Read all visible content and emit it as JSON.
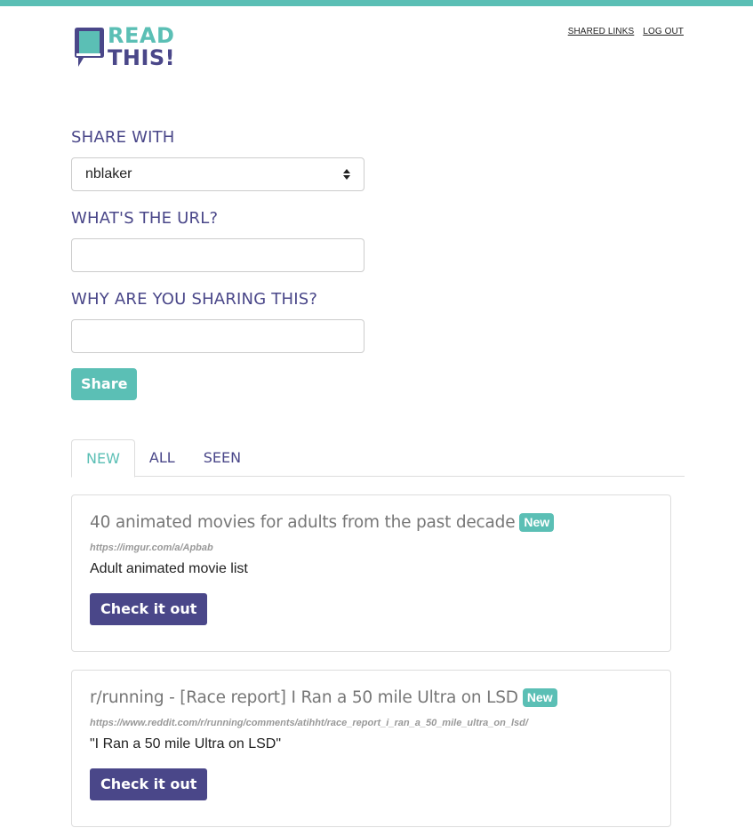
{
  "colors": {
    "teal": "#5bbfb5",
    "purple": "#4a4789",
    "label_purple": "#4a4789"
  },
  "logo": {
    "line1": "READ",
    "line2": "THIS!"
  },
  "nav": {
    "shared_links": "SHARED LINKS",
    "log_out": "LOG OUT"
  },
  "form": {
    "share_with_label": "SHARE WITH",
    "share_with_value": "nblaker",
    "url_label": "WHAT'S THE URL?",
    "url_value": "",
    "reason_label": "WHY ARE YOU SHARING THIS?",
    "reason_value": "",
    "share_button": "Share"
  },
  "tabs": [
    {
      "label": "NEW",
      "active": true
    },
    {
      "label": "ALL",
      "active": false
    },
    {
      "label": "SEEN",
      "active": false
    }
  ],
  "links": [
    {
      "title": "40 animated movies for adults from the past decade",
      "badge": "New",
      "url": "https://imgur.com/a/Apbab",
      "description": "Adult animated movie list",
      "button": "Check it out"
    },
    {
      "title": "r/running - [Race report] I Ran a 50 mile Ultra on LSD",
      "badge": "New",
      "url": "https://www.reddit.com/r/running/comments/atihht/race_report_i_ran_a_50_mile_ultra_on_lsd/",
      "description": "\"I Ran a 50 mile Ultra on LSD\"",
      "button": "Check it out"
    }
  ]
}
